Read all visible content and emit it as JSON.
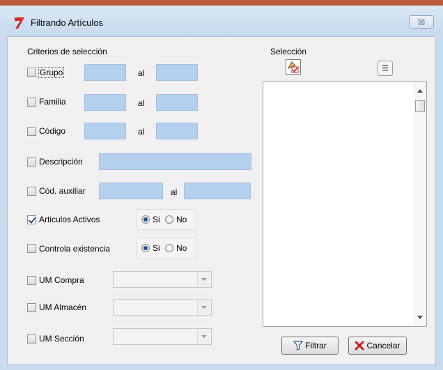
{
  "window": {
    "title": "Filtrando Artículos",
    "close_glyph": "☒"
  },
  "criteria": {
    "heading": "Criterios de selección",
    "rows": [
      {
        "label": "Grupo",
        "checked": false,
        "range_separator": "al"
      },
      {
        "label": "Familia",
        "checked": false,
        "range_separator": "al"
      },
      {
        "label": "Código",
        "checked": false,
        "range_separator": "al"
      },
      {
        "label": "Descripción",
        "checked": false
      },
      {
        "label": "Cód. auxiliar",
        "checked": false,
        "range_separator": "al"
      },
      {
        "label": "Articulos Activos",
        "checked": true,
        "options": [
          "Si",
          "No"
        ],
        "selected": "Si"
      },
      {
        "label": "Controla existencia",
        "checked": false,
        "options": [
          "Si",
          "No"
        ],
        "selected": "Si"
      },
      {
        "label": "UM Compra",
        "checked": false,
        "value": ""
      },
      {
        "label": "UM Almacén",
        "checked": false,
        "value": ""
      },
      {
        "label": "UM Sección",
        "checked": false,
        "value": ""
      }
    ]
  },
  "selection": {
    "heading": "Selección",
    "items": []
  },
  "buttons": {
    "filter": "Filtrar",
    "cancel": "Cancelar"
  },
  "icons": {
    "app": "red-arrow-logo-icon",
    "select_tool": "paint-select-icon",
    "list": "list-icon",
    "filter": "funnel-icon",
    "cancel": "red-x-icon"
  },
  "colors": {
    "field_fill": "#b4d0ef",
    "window_frame": "#c9dbee",
    "logo_red": "#d42a2a",
    "cancel_red": "#c81e1e"
  }
}
